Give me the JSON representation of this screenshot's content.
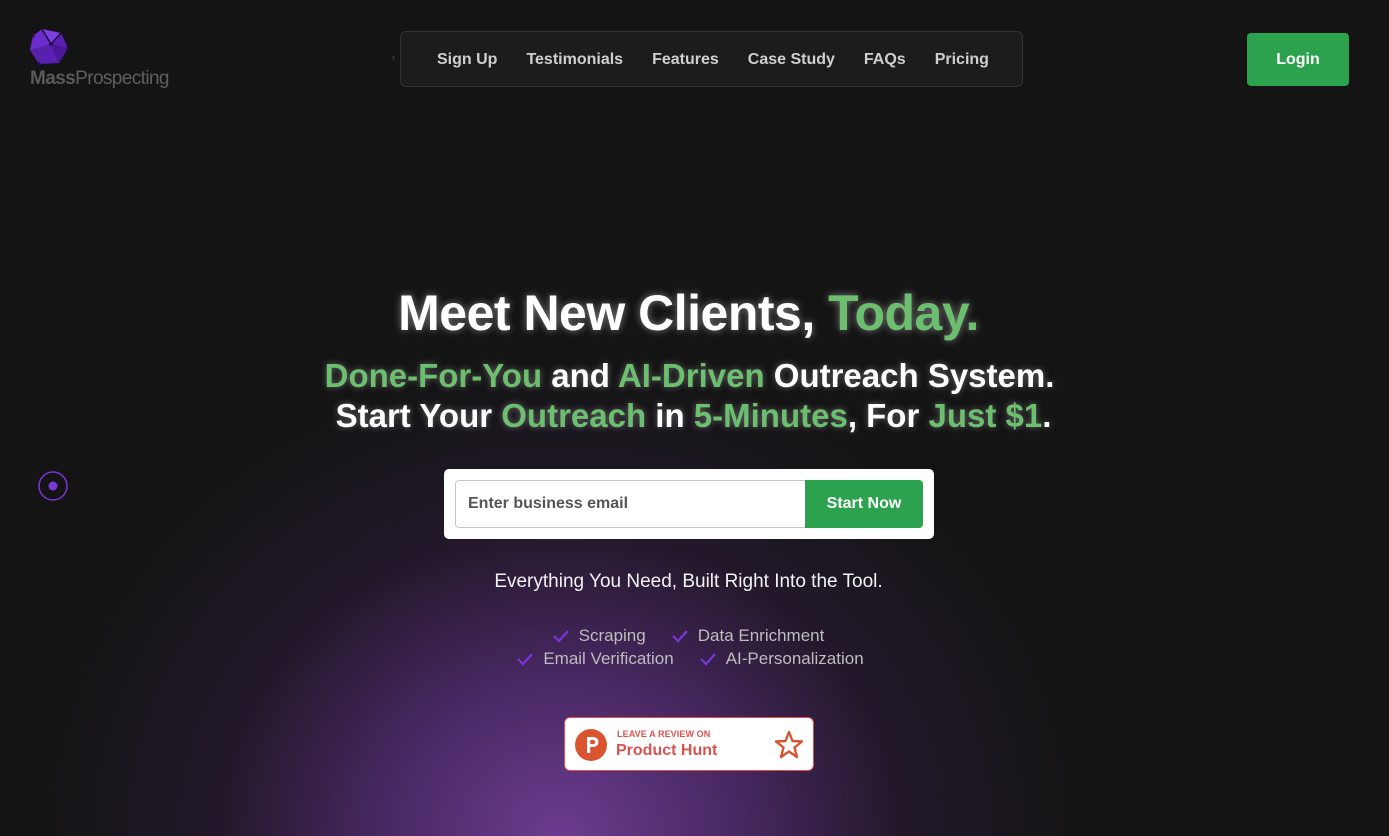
{
  "header": {
    "logo": {
      "text_bold": "Mass",
      "text_light": "Prospecting",
      "icon": "polyhedron-logo-icon"
    },
    "nav_items": [
      {
        "label": "Sign Up"
      },
      {
        "label": "Testimonials"
      },
      {
        "label": "Features"
      },
      {
        "label": "Case Study"
      },
      {
        "label": "FAQs"
      },
      {
        "label": "Pricing"
      }
    ],
    "login_label": "Login"
  },
  "hero": {
    "title_white": "Meet New Clients, ",
    "title_green": "Today.",
    "sub1": {
      "g1": "Done-For-You",
      "w1": " and ",
      "g2": "AI-Driven",
      "w2": " Outreach System."
    },
    "sub2": {
      "w1": "Start Your ",
      "g1": "Outreach",
      "w2": " in ",
      "g2": "5-Minutes",
      "w3": ", For ",
      "g3": "Just $1",
      "w4": "."
    }
  },
  "signup_form": {
    "email_placeholder": "Enter business email",
    "email_value": "",
    "submit_label": "Start Now"
  },
  "tagline": "Everything You Need, Built Right Into the Tool.",
  "features_row1": [
    "Scraping",
    "Data Enrichment"
  ],
  "features_row2": [
    "Email Verification",
    "AI-Personalization"
  ],
  "product_hunt": {
    "small_text": "LEAVE A REVIEW ON",
    "big_text": "Product Hunt",
    "icons": [
      "product-hunt-p-icon",
      "star-icon"
    ]
  },
  "colors": {
    "background": "#141414",
    "accent_green": "#6cbf6f",
    "button_green": "#2ca24f",
    "purple_glow": "#703e96",
    "check_purple": "#7b35d9",
    "product_hunt_red": "#da552f"
  }
}
